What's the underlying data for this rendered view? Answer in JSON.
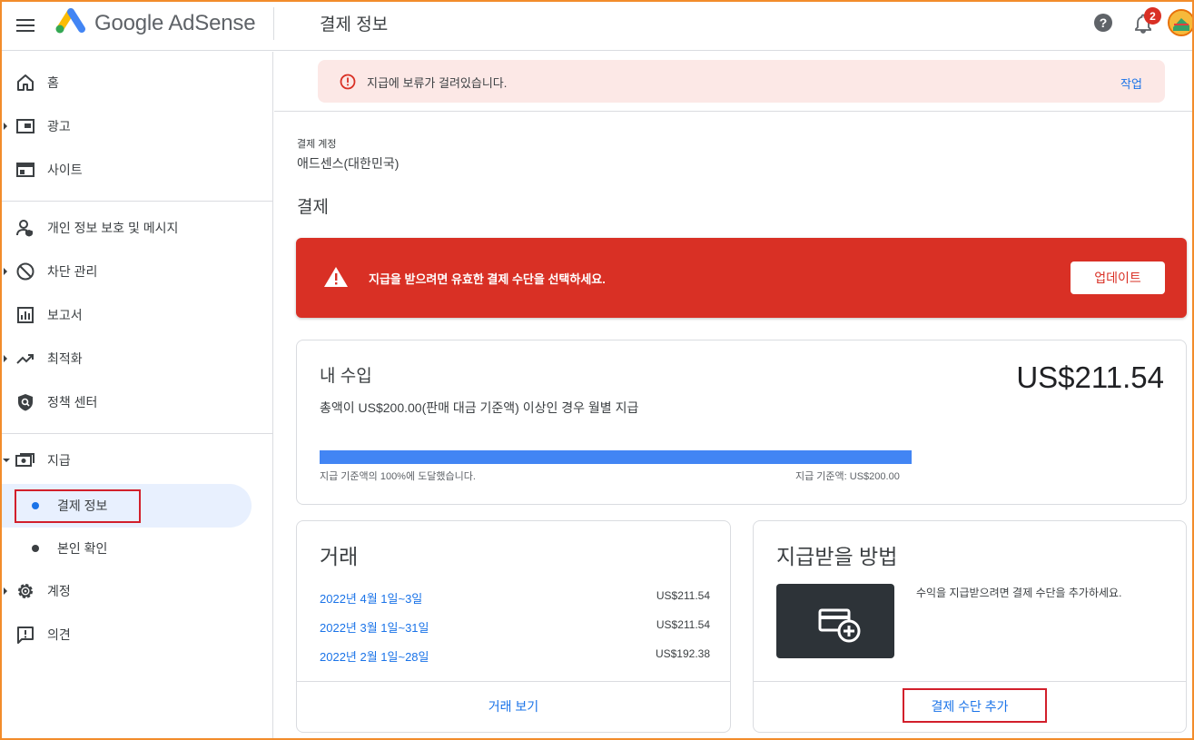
{
  "header": {
    "brand": "Google AdSense",
    "page_title": "결제 정보",
    "notification_count": "2"
  },
  "sidebar": {
    "items": [
      {
        "label": "홈",
        "icon": "home-icon"
      },
      {
        "label": "광고",
        "icon": "ads-icon"
      },
      {
        "label": "사이트",
        "icon": "sites-icon"
      },
      {
        "label": "개인 정보 보호 및 메시지",
        "icon": "privacy-messaging-icon"
      },
      {
        "label": "차단 관리",
        "icon": "block-icon"
      },
      {
        "label": "보고서",
        "icon": "reports-icon"
      },
      {
        "label": "최적화",
        "icon": "trending-up-icon"
      },
      {
        "label": "정책 센터",
        "icon": "policy-shield-icon"
      },
      {
        "label": "지급",
        "icon": "payments-icon"
      },
      {
        "label": "계정",
        "icon": "settings-icon"
      },
      {
        "label": "의견",
        "icon": "feedback-icon"
      }
    ],
    "payments_sub": [
      {
        "label": "결제 정보"
      },
      {
        "label": "본인 확인"
      }
    ]
  },
  "alert": {
    "text": "지급에 보류가 걸려있습니다.",
    "action": "작업"
  },
  "account": {
    "label": "결제 계정",
    "name": "애드센스(대한민국)"
  },
  "section_title": "결제",
  "banner": {
    "text": "지급을 받으려면 유효한 결제 수단을 선택하세요.",
    "button": "업데이트",
    "color": "#d93025"
  },
  "earnings": {
    "title": "내 수입",
    "amount": "US$211.54",
    "description": "총액이 US$200.00(판매 대금 기준액) 이상인 경우 월별 지급",
    "progress_percent": 100,
    "progress_label": "지급 기준액의 100%에 도달했습니다.",
    "threshold_label": "지급 기준액: US$200.00"
  },
  "transactions": {
    "title": "거래",
    "rows": [
      {
        "date": "2022년 4월 1일~3일",
        "amount": "US$211.54"
      },
      {
        "date": "2022년 3월 1일~31일",
        "amount": "US$211.54"
      },
      {
        "date": "2022년 2월 1일~28일",
        "amount": "US$192.38"
      }
    ],
    "view_all": "거래 보기"
  },
  "payment_method": {
    "title": "지급받을 방법",
    "description": "수익을 지급받으려면 결제 수단을 추가하세요.",
    "add_button": "결제 수단 추가"
  }
}
